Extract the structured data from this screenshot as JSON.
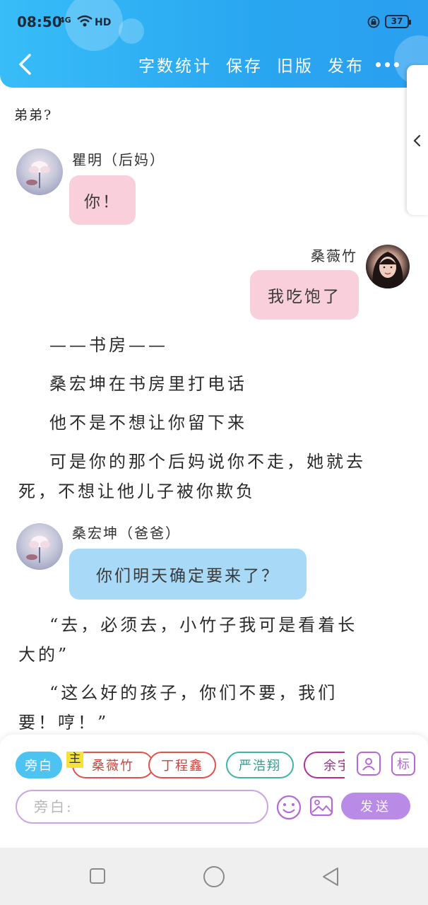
{
  "status_bar": {
    "time": "08:50",
    "signal": "4G",
    "network": "HD",
    "battery": "37"
  },
  "header": {
    "actions": [
      "字数统计",
      "保存",
      "旧版",
      "发布"
    ],
    "more_icon": "more-dots-icon",
    "back_icon": "chevron-left-icon"
  },
  "content": {
    "partial_line": "弟弟?",
    "messages": [
      {
        "speaker": "瞿明（后妈）",
        "text": "你！",
        "side": "left",
        "color": "#f9cfdb"
      },
      {
        "speaker": "桑薇竹",
        "text": "我吃饱了",
        "side": "right",
        "color": "#f9cfdb"
      },
      {
        "speaker": "桑宏坤（爸爸）",
        "text": "你们明天确定要来了？",
        "side": "left",
        "color": "#a8daf8"
      }
    ],
    "narration": {
      "p1": "——书房——",
      "p2": "桑宏坤在书房里打电话",
      "p3": "他不是不想让你留下来",
      "p4a": "可是你的那个后妈说你不走，她就去",
      "p4b": "死，不想让他儿子被你欺负",
      "p5a": "“去，必须去，小竹子我可是看着长",
      "p5b": "大的”",
      "p6a": "“这么好的孩子，你们不要，我们",
      "p6b": "要！哼！”"
    }
  },
  "composer": {
    "chips": [
      "旁白",
      "桑薇竹",
      "丁程鑫",
      "严浩翔",
      "余宇"
    ],
    "main_badge": "主",
    "chip_colors": [
      "#4cc3f0",
      "#e0524a",
      "#e0524a",
      "#3fb4a6",
      "#b0309a"
    ],
    "icon_mark": "标",
    "placeholder": "旁白:",
    "send_label": "发送"
  }
}
